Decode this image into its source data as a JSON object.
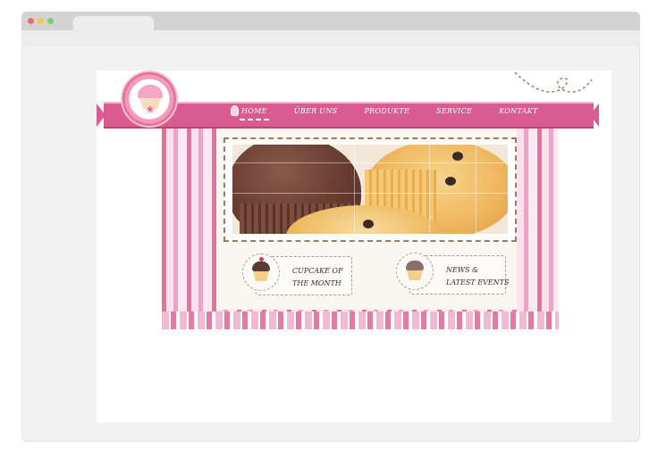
{
  "browser": {
    "title": ""
  },
  "site": {
    "nav": [
      {
        "label": "Home",
        "active": true
      },
      {
        "label": "Über uns",
        "active": false
      },
      {
        "label": "Produkte",
        "active": false
      },
      {
        "label": "Service",
        "active": false
      },
      {
        "label": "Kontakt",
        "active": false
      }
    ],
    "features": [
      {
        "line1": "Cupcake of",
        "line2": "the month"
      },
      {
        "line1": "News &",
        "line2": "latest events"
      }
    ],
    "colors": {
      "ribbon": "#d95b8f",
      "stripe_dark": "#e3729f",
      "stripe_light": "#fbe1ed",
      "frame_border": "#9c7a5c"
    }
  }
}
